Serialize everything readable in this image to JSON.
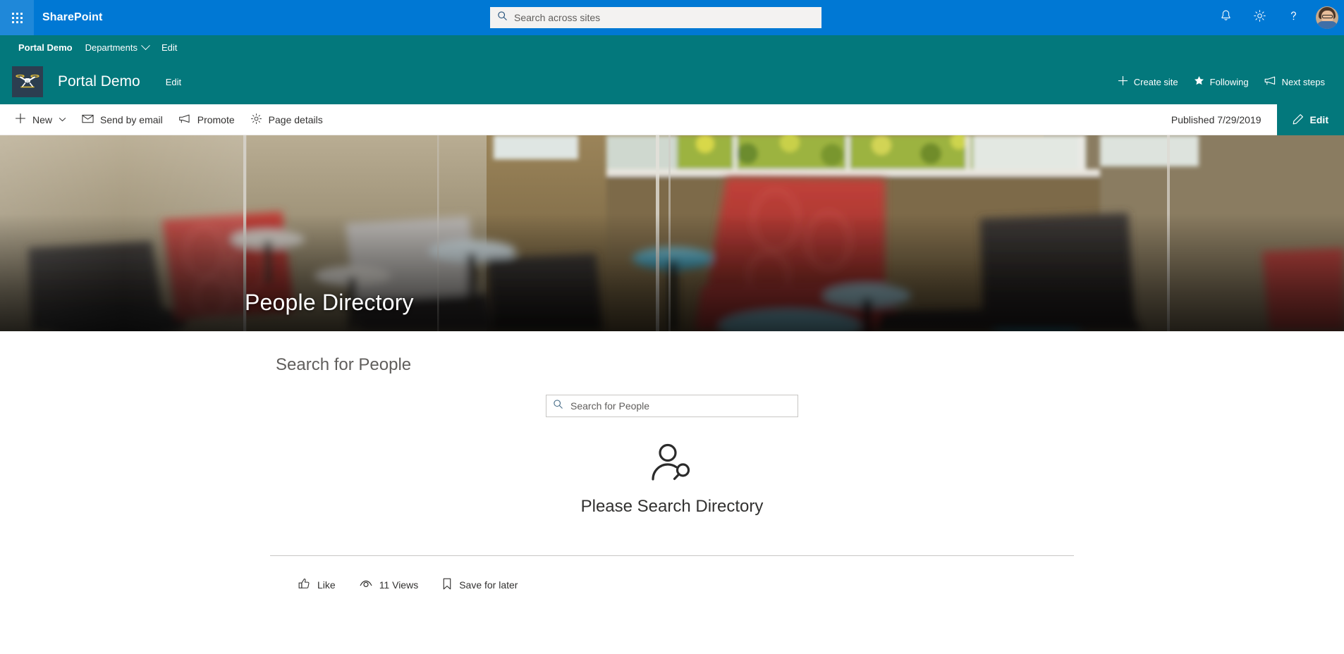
{
  "suite": {
    "brand": "SharePoint",
    "waffle_label": "app-launcher",
    "search": {
      "placeholder": "Search across sites",
      "value": ""
    },
    "icons": {
      "notifications": "bell-icon",
      "settings": "gear-icon",
      "help": "help-icon",
      "account": "user-avatar"
    },
    "accent_color": "#0078d4"
  },
  "hub_nav": {
    "items": [
      {
        "label": "Portal Demo",
        "bold": true,
        "has_chevron": false
      },
      {
        "label": "Departments",
        "bold": false,
        "has_chevron": true
      },
      {
        "label": "Edit",
        "bold": false,
        "has_chevron": false
      }
    ],
    "background": "#03787c"
  },
  "site_header": {
    "logo": "drone-logo",
    "title": "Portal Demo",
    "edit_label": "Edit",
    "actions": [
      {
        "label": "Create site",
        "icon": "plus-icon"
      },
      {
        "label": "Following",
        "icon": "star-icon"
      },
      {
        "label": "Next steps",
        "icon": "megaphone-icon"
      }
    ],
    "background": "#03787c"
  },
  "command_bar": {
    "items": [
      {
        "label": "New",
        "icon": "plus-icon",
        "has_chevron": true
      },
      {
        "label": "Send by email",
        "icon": "mail-icon",
        "has_chevron": false
      },
      {
        "label": "Promote",
        "icon": "megaphone-icon",
        "has_chevron": false
      },
      {
        "label": "Page details",
        "icon": "gear-icon",
        "has_chevron": false
      }
    ],
    "published_status": "Published 7/29/2019",
    "edit_button": {
      "label": "Edit",
      "icon": "pencil-icon",
      "color": "#03787c"
    }
  },
  "hero": {
    "title": "People Directory",
    "image_description": "office-lounge-photo"
  },
  "webpart": {
    "title": "Search for People",
    "search": {
      "placeholder": "Search for People",
      "value": "",
      "icon": "search-icon"
    },
    "empty_state": {
      "icon": "person-search-icon",
      "message": "Please Search Directory"
    }
  },
  "page_footer": {
    "actions": [
      {
        "label": "Like",
        "icon": "thumbs-up-icon",
        "interactable": true
      },
      {
        "label": "11 Views",
        "icon": "eye-icon",
        "interactable": false
      },
      {
        "label": "Save for later",
        "icon": "bookmark-icon",
        "interactable": true
      }
    ]
  }
}
